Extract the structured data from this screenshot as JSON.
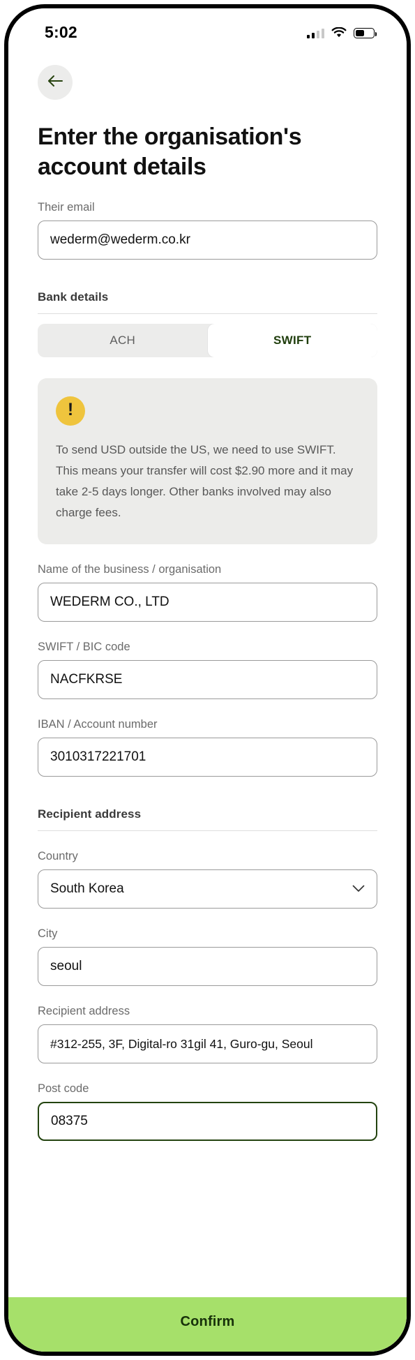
{
  "status_bar": {
    "time": "5:02",
    "signal_icon": "cellular-signal-icon",
    "wifi_icon": "wifi-icon",
    "battery_icon": "battery-icon"
  },
  "header": {
    "back_icon": "back-arrow-icon",
    "title": "Enter the organisation's account details"
  },
  "email_field": {
    "label": "Their email",
    "value": "wederm@wederm.co.kr",
    "placeholder": "Their email"
  },
  "bank_details": {
    "section_title": "Bank details",
    "tabs": [
      {
        "label": "ACH",
        "selected": false
      },
      {
        "label": "SWIFT",
        "selected": true
      }
    ]
  },
  "alert": {
    "icon": "warning-exclamation-icon",
    "icon_glyph": "!",
    "color": "#efc43d",
    "text": "To send USD outside the US, we need to use SWIFT. This means your transfer will cost $2.90 more and it may take 2-5 days longer. Other banks involved may also charge fees."
  },
  "business_name_field": {
    "label": "Name of the business / organisation",
    "value": "WEDERM CO., LTD",
    "placeholder": "Name of the business / organisation"
  },
  "swift_field": {
    "label": "SWIFT / BIC code",
    "value": "NACFKRSE",
    "placeholder": "SWIFT / BIC code"
  },
  "iban_field": {
    "label": "IBAN / Account number",
    "value": "3010317221701",
    "placeholder": "IBAN / Account number"
  },
  "recipient_address": {
    "section_title": "Recipient address",
    "country_field": {
      "label": "Country",
      "value": "South Korea",
      "chevron_icon": "chevron-down-icon"
    },
    "city_field": {
      "label": "City",
      "value": "seoul",
      "placeholder": "City"
    },
    "address_field": {
      "label": "Recipient address",
      "value": "#312-255, 3F, Digital-ro 31gil 41, Guro-gu, Seoul",
      "placeholder": "Recipient address"
    },
    "postcode_field": {
      "label": "Post code",
      "value": "08375",
      "placeholder": "Post code",
      "focused": true,
      "focus_color": "#23430f"
    }
  },
  "confirm_button": {
    "label": "Confirm",
    "background": "#a6e06a"
  }
}
